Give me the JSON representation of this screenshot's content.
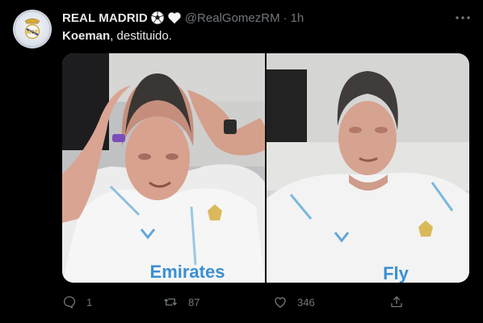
{
  "tweet": {
    "display_name": "REAL MADRID",
    "name_emojis": [
      "soccer-ball-icon",
      "white-heart-icon"
    ],
    "handle": "@RealGomezRM",
    "separator": "·",
    "time": "1h",
    "text_bold": "Koeman",
    "text_rest": ", destituido.",
    "media": [
      {
        "name": "photo-left",
        "shirt_text": "Emirates"
      },
      {
        "name": "photo-right",
        "shirt_text": "Fly"
      }
    ],
    "actions": {
      "replies": "1",
      "retweets": "87",
      "likes": "346"
    }
  },
  "colors": {
    "background": "#000000",
    "text": "#e7e9ea",
    "secondary": "#71767b"
  },
  "icons": {
    "more": "more-dots-icon",
    "reply": "reply-icon",
    "retweet": "retweet-icon",
    "like": "like-icon",
    "share": "share-icon"
  }
}
